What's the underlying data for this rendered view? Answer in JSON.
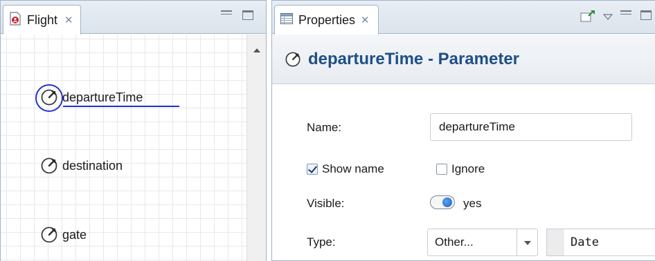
{
  "left_panel": {
    "tab_title": "Flight",
    "close_glyph": "✕",
    "parameters": [
      {
        "label": "departureTime",
        "selected": true
      },
      {
        "label": "destination",
        "selected": false
      },
      {
        "label": "gate",
        "selected": false
      }
    ]
  },
  "right_panel": {
    "tab_title": "Properties",
    "close_glyph": "✕",
    "header_title": "departureTime - Parameter",
    "form": {
      "name_label": "Name:",
      "name_value": "departureTime",
      "show_name_label": "Show name",
      "show_name_checked": true,
      "ignore_label": "Ignore",
      "ignore_checked": false,
      "visible_label": "Visible:",
      "visible_value": "yes",
      "type_label": "Type:",
      "type_select_value": "Other...",
      "type_value": "Date"
    }
  },
  "colors": {
    "header_title": "#1e4f86",
    "selection": "#2030d0",
    "panel_border": "#a0b4c8"
  },
  "icons": [
    "flight-agent-icon",
    "close-icon",
    "minimize-icon",
    "maximize-icon",
    "parameter-icon",
    "properties-table-icon",
    "pin-icon",
    "view-menu-icon",
    "scroll-up-arrow"
  ]
}
